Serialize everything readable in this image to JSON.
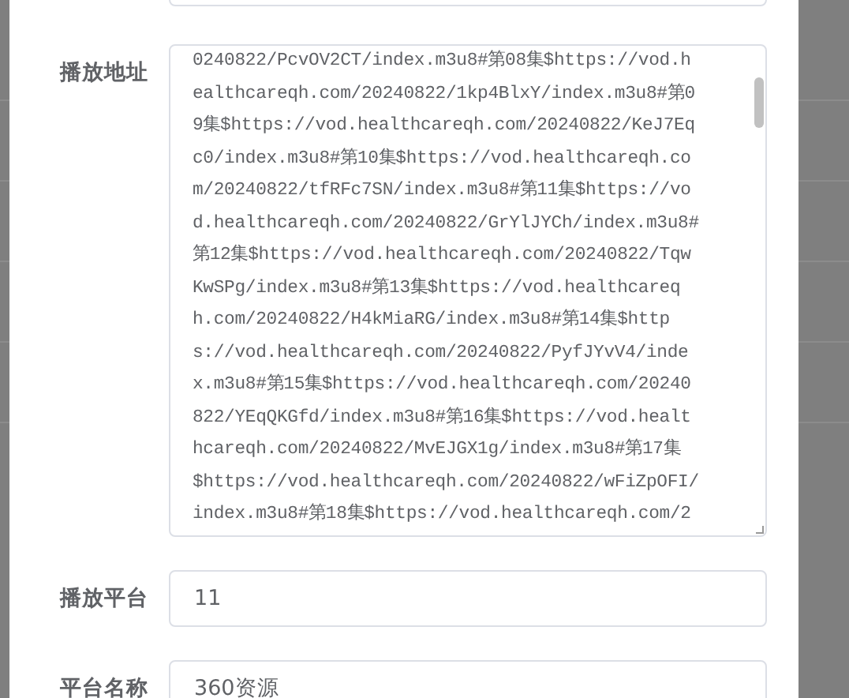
{
  "form": {
    "fields": [
      {
        "kind": "textarea",
        "label": "播放地址",
        "value": "0240822/PcvOV2CT/index.m3u8#第08集$https://vod.h\nealthcareqh.com/20240822/1kp4BlxY/index.m3u8#第0\n9集$https://vod.healthcareqh.com/20240822/KeJ7Eq\nc0/index.m3u8#第10集$https://vod.healthcareqh.co\nm/20240822/tfRFc7SN/index.m3u8#第11集$https://vo\nd.healthcareqh.com/20240822/GrYlJYCh/index.m3u8#\n第12集$https://vod.healthcareqh.com/20240822/Tqw\nKwSPg/index.m3u8#第13集$https://vod.healthcareq\nh.com/20240822/H4kMiaRG/index.m3u8#第14集$http\ns://vod.healthcareqh.com/20240822/PyfJYvV4/inde\nx.m3u8#第15集$https://vod.healthcareqh.com/20240\n822/YEqQKGfd/index.m3u8#第16集$https://vod.healt\nhcareqh.com/20240822/MvEJGX1g/index.m3u8#第17集\n$https://vod.healthcareqh.com/20240822/wFiZpOFI/\nindex.m3u8#第18集$https://vod.healthcareqh.com/2"
      },
      {
        "kind": "input",
        "label": "播放平台",
        "value": "11"
      },
      {
        "kind": "input",
        "label": "平台名称",
        "value": "360资源"
      }
    ]
  }
}
